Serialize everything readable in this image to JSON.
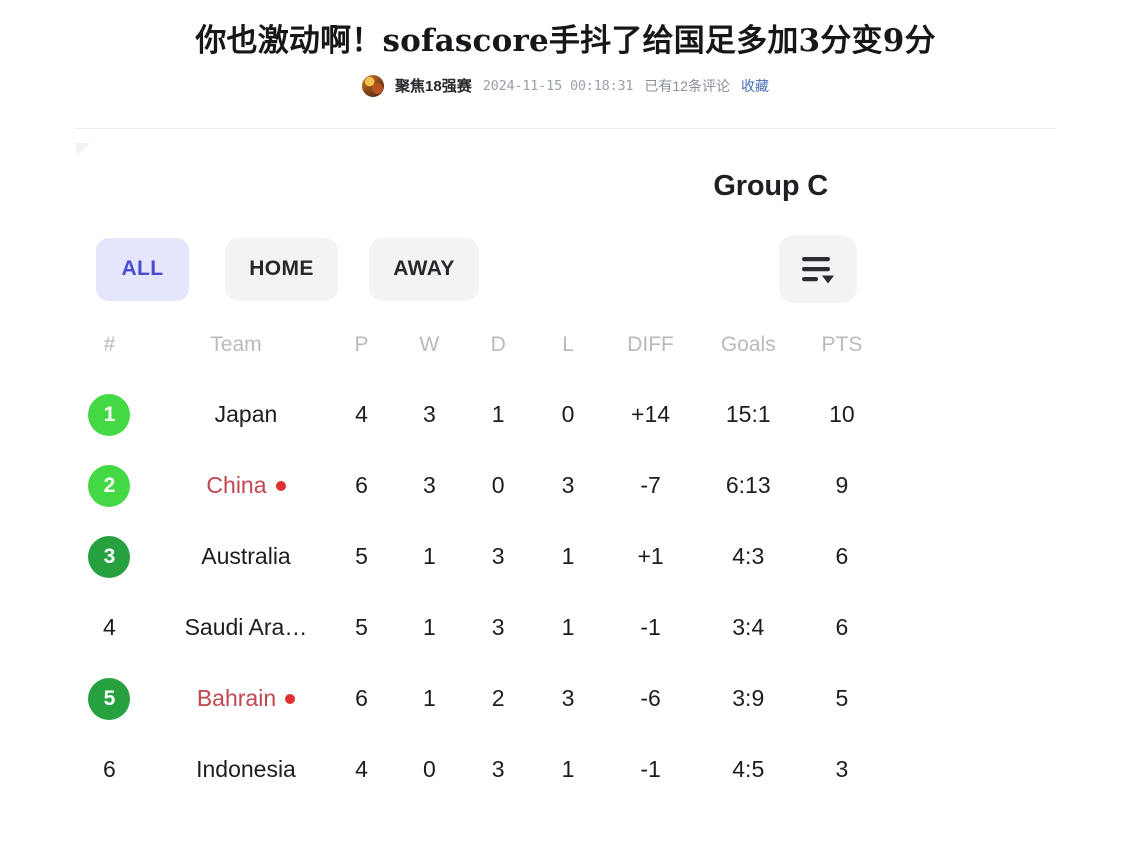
{
  "article": {
    "title": "你也激动啊！sofascore手抖了给国足多加3分变9分",
    "author": "聚焦18强赛",
    "date": "2024-11-15 00:18:31",
    "comments": "已有12条评论",
    "favorite": "收藏",
    "avatar_icon": "user-avatar-icon"
  },
  "standings": {
    "group_title": "Group C",
    "filters": [
      {
        "label": "ALL",
        "active": true
      },
      {
        "label": "HOME",
        "active": false
      },
      {
        "label": "AWAY",
        "active": false
      }
    ],
    "sort_icon": "sort-descending-icon",
    "columns": [
      "#",
      "Team",
      "P",
      "W",
      "D",
      "L",
      "DIFF",
      "Goals",
      "PTS"
    ],
    "rows": [
      {
        "rank": "1",
        "badge": "light",
        "team": "Japan",
        "team_red": false,
        "dot": false,
        "p": "4",
        "w": "3",
        "d": "1",
        "l": "0",
        "diff": "+14",
        "goals": "15:1",
        "pts": "10",
        "w_red": false,
        "l_red": false,
        "pts_red": false
      },
      {
        "rank": "2",
        "badge": "light",
        "team": "China",
        "team_red": true,
        "dot": true,
        "p": "6",
        "w": "3",
        "d": "0",
        "l": "3",
        "diff": "-7",
        "goals": "6:13",
        "pts": "9",
        "w_red": true,
        "l_red": false,
        "pts_red": true
      },
      {
        "rank": "3",
        "badge": "dark",
        "team": "Australia",
        "team_red": false,
        "dot": false,
        "p": "5",
        "w": "1",
        "d": "3",
        "l": "1",
        "diff": "+1",
        "goals": "4:3",
        "pts": "6",
        "w_red": false,
        "l_red": false,
        "pts_red": false
      },
      {
        "rank": "4",
        "badge": "none",
        "team": "Saudi Ara…",
        "team_red": false,
        "dot": false,
        "p": "5",
        "w": "1",
        "d": "3",
        "l": "1",
        "diff": "-1",
        "goals": "3:4",
        "pts": "6",
        "w_red": false,
        "l_red": false,
        "pts_red": false
      },
      {
        "rank": "5",
        "badge": "dark",
        "team": "Bahrain",
        "team_red": true,
        "dot": true,
        "p": "6",
        "w": "1",
        "d": "2",
        "l": "3",
        "diff": "-6",
        "goals": "3:9",
        "pts": "5",
        "w_red": false,
        "l_red": true,
        "pts_red": true
      },
      {
        "rank": "6",
        "badge": "none",
        "team": "Indonesia",
        "team_red": false,
        "dot": false,
        "p": "4",
        "w": "0",
        "d": "3",
        "l": "1",
        "diff": "-1",
        "goals": "4:5",
        "pts": "3",
        "w_red": false,
        "l_red": false,
        "pts_red": false
      }
    ]
  },
  "colors": {
    "accent_purple": "#4b4bd4",
    "accent_purple_bg": "#e5e5fb",
    "badge_light_green": "#45d845",
    "badge_dark_green": "#27a03f",
    "red_text": "#c0474f",
    "red_dot": "#e0302f",
    "link_blue": "#4a6fb5",
    "header_gray": "#b6bac1"
  }
}
